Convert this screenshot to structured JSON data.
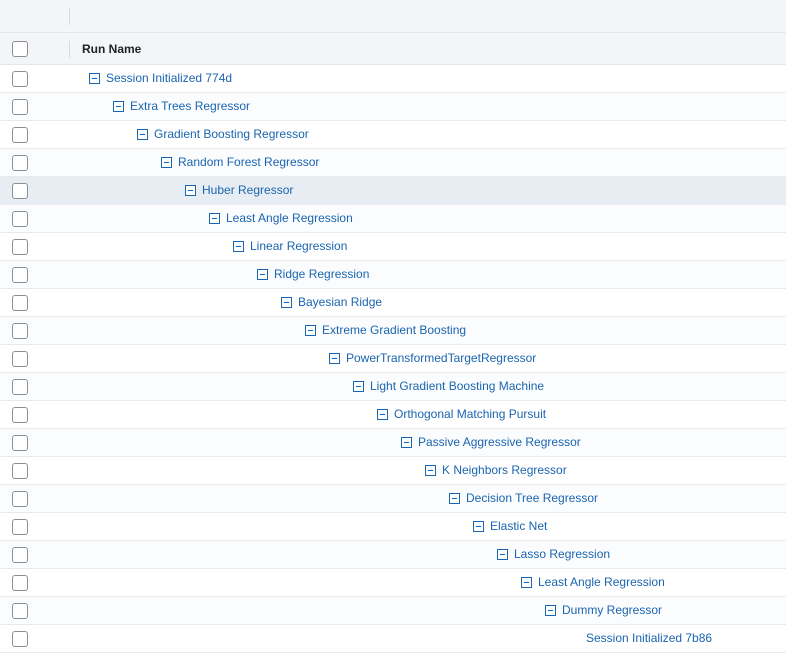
{
  "table": {
    "header": {
      "run_name_label": "Run Name"
    },
    "rows": [
      {
        "label": "Session Initialized 774d",
        "level": 0,
        "expanded": true
      },
      {
        "label": "Extra Trees Regressor",
        "level": 1,
        "expanded": true
      },
      {
        "label": "Gradient Boosting Regressor",
        "level": 2,
        "expanded": true
      },
      {
        "label": "Random Forest Regressor",
        "level": 3,
        "expanded": true
      },
      {
        "label": "Huber Regressor",
        "level": 4,
        "expanded": true,
        "selected": true
      },
      {
        "label": "Least Angle Regression",
        "level": 5,
        "expanded": true
      },
      {
        "label": "Linear Regression",
        "level": 6,
        "expanded": true
      },
      {
        "label": "Ridge Regression",
        "level": 7,
        "expanded": true
      },
      {
        "label": "Bayesian Ridge",
        "level": 8,
        "expanded": true
      },
      {
        "label": "Extreme Gradient Boosting",
        "level": 9,
        "expanded": true
      },
      {
        "label": "PowerTransformedTargetRegressor",
        "level": 10,
        "expanded": true
      },
      {
        "label": "Light Gradient Boosting Machine",
        "level": 11,
        "expanded": true
      },
      {
        "label": "Orthogonal Matching Pursuit",
        "level": 12,
        "expanded": true
      },
      {
        "label": "Passive Aggressive Regressor",
        "level": 13,
        "expanded": true
      },
      {
        "label": "K Neighbors Regressor",
        "level": 14,
        "expanded": true
      },
      {
        "label": "Decision Tree Regressor",
        "level": 15,
        "expanded": true
      },
      {
        "label": "Elastic Net",
        "level": 16,
        "expanded": true
      },
      {
        "label": "Lasso Regression",
        "level": 17,
        "expanded": true
      },
      {
        "label": "Least Angle Regression",
        "level": 18,
        "expanded": true
      },
      {
        "label": "Dummy Regressor",
        "level": 19,
        "expanded": true
      },
      {
        "label": "Session Initialized 7b86",
        "level": 20,
        "expanded": false
      }
    ]
  },
  "colors": {
    "link": "#1a65b0",
    "selected_row": "#e8edf3"
  }
}
